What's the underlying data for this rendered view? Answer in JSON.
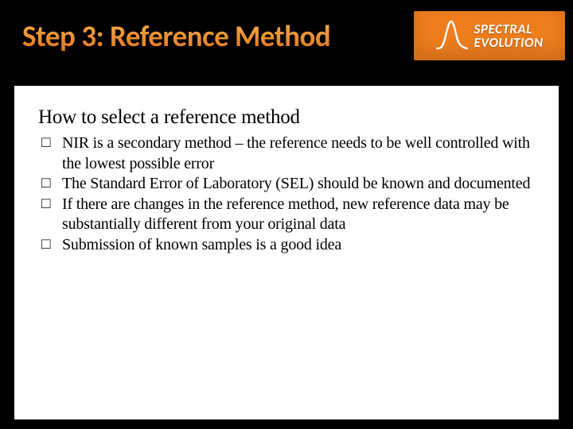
{
  "header": {
    "title": "Step 3: Reference Method",
    "logo_line1": "SPECTRAL",
    "logo_line2": "EVOLUTION"
  },
  "content": {
    "subhead": "How to select a reference method",
    "bullets": [
      "NIR is a secondary method – the reference needs to be well controlled with the lowest possible error",
      "The Standard Error of Laboratory (SEL) should be known and documented",
      "If there are changes in the reference method, new reference data may be substantially different from your original data",
      "Submission of known samples is a good idea"
    ]
  }
}
